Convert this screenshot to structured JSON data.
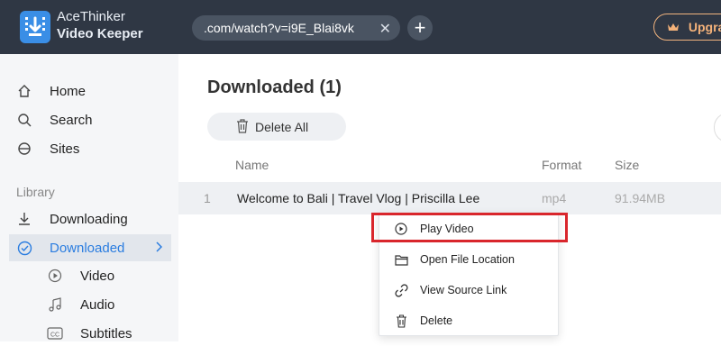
{
  "app": {
    "name_line1": "AceThinker",
    "name_line2": "Video Keeper"
  },
  "titlebar": {
    "url": ".com/watch?v=i9E_Blai8vk",
    "close_glyph": "✕",
    "add_glyph": "+",
    "upgrade_label": "Upgra"
  },
  "sidebar": {
    "items": [
      {
        "label": "Home",
        "icon": "home-icon"
      },
      {
        "label": "Search",
        "icon": "search-icon"
      },
      {
        "label": "Sites",
        "icon": "sites-icon"
      }
    ],
    "library_label": "Library",
    "library_items": [
      {
        "label": "Downloading",
        "icon": "download-icon"
      },
      {
        "label": "Downloaded",
        "icon": "check-circle-icon",
        "active": true
      }
    ],
    "sub_items": [
      {
        "label": "Video",
        "icon": "play-circle-icon"
      },
      {
        "label": "Audio",
        "icon": "music-note-icon"
      },
      {
        "label": "Subtitles",
        "icon": "cc-icon"
      }
    ]
  },
  "main": {
    "title": "Downloaded (1)",
    "delete_all_label": "Delete All",
    "columns": {
      "name": "Name",
      "format": "Format",
      "size": "Size"
    },
    "rows": [
      {
        "index": "1",
        "name": "Welcome to Bali | Travel Vlog | Priscilla Lee",
        "format": "mp4",
        "size": "91.94MB"
      }
    ]
  },
  "context_menu": {
    "items": [
      {
        "label": "Play Video",
        "icon": "play-circle-icon"
      },
      {
        "label": "Open File Location",
        "icon": "folder-icon"
      },
      {
        "label": "View Source Link",
        "icon": "link-icon"
      },
      {
        "label": "Delete",
        "icon": "trash-icon"
      }
    ]
  },
  "colors": {
    "titlebar": "#2f3744",
    "accent": "#2b7de0",
    "highlight": "#d9262c",
    "upgrade": "#f4b27a"
  }
}
